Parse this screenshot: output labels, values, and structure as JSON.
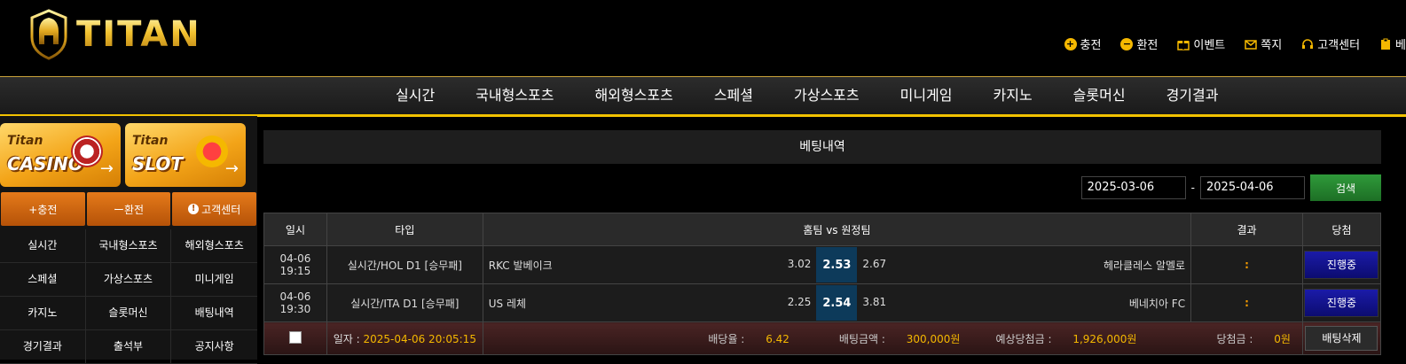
{
  "header": {
    "logo_text": "TITAN",
    "top_menu": [
      {
        "icon": "plus-circle-icon",
        "label": "충전"
      },
      {
        "icon": "minus-circle-icon",
        "label": "환전"
      },
      {
        "icon": "gift-icon",
        "label": "이벤트"
      },
      {
        "icon": "mail-icon",
        "label": "쪽지"
      },
      {
        "icon": "headset-icon",
        "label": "고객센터"
      },
      {
        "icon": "clipboard-icon",
        "label": "베"
      }
    ]
  },
  "nav": [
    "실시간",
    "국내형스포츠",
    "해외형스포츠",
    "스페셜",
    "가상스포츠",
    "미니게임",
    "카지노",
    "슬롯머신",
    "경기결과"
  ],
  "sidebar": {
    "banners": [
      {
        "line1": "Titan",
        "line2": "CASINO"
      },
      {
        "line1": "Titan",
        "line2": "SLOT"
      }
    ],
    "buttons": [
      "+충전",
      "ー환전",
      "고객센터"
    ],
    "grid": [
      "실시간",
      "국내형스포츠",
      "해외형스포츠",
      "스페셜",
      "가상스포츠",
      "미니게임",
      "카지노",
      "슬롯머신",
      "배팅내역",
      "경기결과",
      "출석부",
      "공지사항"
    ]
  },
  "main": {
    "title": "베팅내역",
    "date_from": "2025-03-06",
    "date_sep": "-",
    "date_to": "2025-04-06",
    "search_label": "검색",
    "columns": [
      "일시",
      "타입",
      "홈팀 vs 원정팀",
      "결과",
      "당첨"
    ],
    "rows": [
      {
        "time": "04-06 19:15",
        "type": "실시간/HOL D1 [승무패]",
        "home": "RKC 발베이크",
        "home_odds": "3.02",
        "draw": "2.53",
        "away_odds": "2.67",
        "away": "헤라클레스 알멜로",
        "result": ":",
        "status": "진행중"
      },
      {
        "time": "04-06 19:30",
        "type": "실시간/ITA D1 [승무패]",
        "home": "US 레체",
        "home_odds": "2.25",
        "draw": "2.54",
        "away_odds": "3.81",
        "away": "베네치아 FC",
        "result": ":",
        "status": "진행중"
      }
    ],
    "summary": {
      "date_label": "일자 :",
      "date_value": "2025-04-06 20:05:15",
      "odds_label": "배당율 :",
      "odds_value": "6.42",
      "bet_label": "배팅금액 :",
      "bet_value": "300,000원",
      "expected_label": "예상당첨금 :",
      "expected_value": "1,926,000원",
      "win_label": "당첨금 :",
      "win_value": "0원",
      "delete_label": "배팅삭제"
    }
  }
}
